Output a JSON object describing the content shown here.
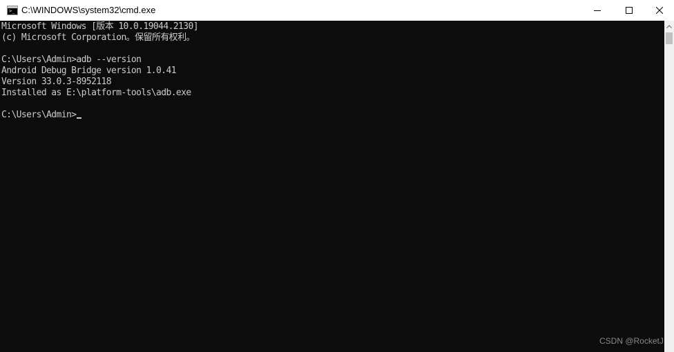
{
  "window": {
    "title": "C:\\WINDOWS\\system32\\cmd.exe",
    "icon": "cmd-prompt-icon",
    "controls": {
      "minimize": "minimize-icon",
      "maximize": "maximize-icon",
      "close": "close-icon"
    }
  },
  "console": {
    "lines": [
      "Microsoft Windows [版本 10.0.19044.2130]",
      "(c) Microsoft Corporation。保留所有权利。",
      "",
      "C:\\Users\\Admin>adb --version",
      "Android Debug Bridge version 1.0.41",
      "Version 33.0.3-8952118",
      "Installed as E:\\platform-tools\\adb.exe",
      "",
      "C:\\Users\\Admin>"
    ],
    "colors": {
      "background": "#0c0c0c",
      "foreground": "#cccccc"
    }
  },
  "watermark": "CSDN @RocketJ"
}
